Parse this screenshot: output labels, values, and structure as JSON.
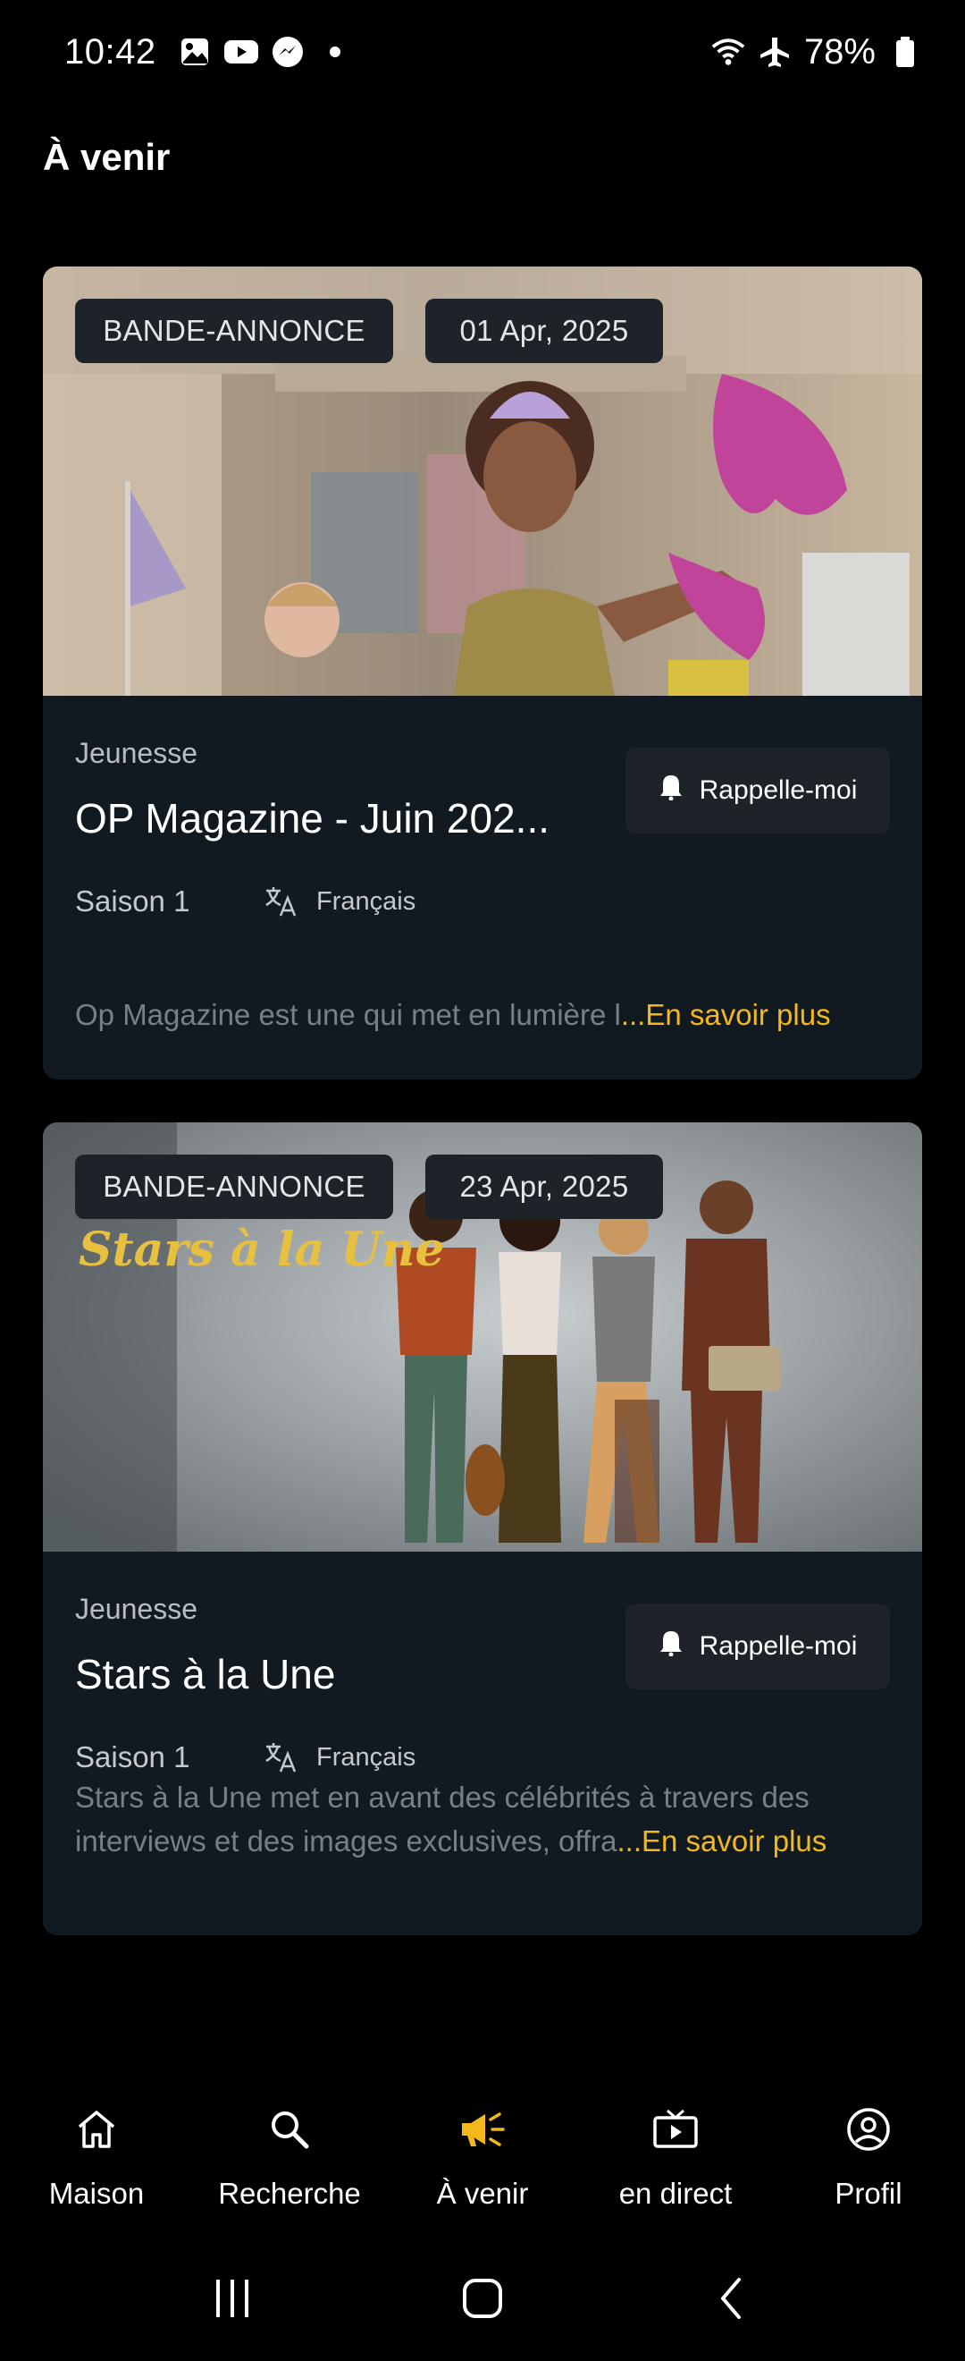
{
  "status_bar": {
    "time": "10:42",
    "battery": "78%",
    "icons": [
      "gallery-icon",
      "youtube-icon",
      "messenger-icon",
      "wifi-icon",
      "airplane-icon",
      "battery-icon"
    ]
  },
  "header": {
    "title": "À venir"
  },
  "cards": [
    {
      "chip_type": "BANDE-ANNONCE",
      "chip_date": "01 Apr, 2025",
      "genre": "Jeunesse",
      "title": "OP Magazine - Juin 202...",
      "remind_label": "Rappelle-moi",
      "season": "Saison 1",
      "language": "Français",
      "description": "Op Magazine est une qui met en lumière l",
      "more_label": "...En savoir plus"
    },
    {
      "chip_type": "BANDE-ANNONCE",
      "chip_date": "23 Apr, 2025",
      "image_caption": "Stars à la Une",
      "genre": "Jeunesse",
      "title": "Stars à la Une",
      "remind_label": "Rappelle-moi",
      "season": "Saison 1",
      "language": "Français",
      "description": "Stars à la Une met en avant des célébrités à travers des interviews et des images exclusives, offra",
      "more_label": "...En savoir plus"
    }
  ],
  "bottom_nav": {
    "items": [
      {
        "label": "Maison",
        "icon": "home-icon"
      },
      {
        "label": "Recherche",
        "icon": "search-icon"
      },
      {
        "label": "À venir",
        "icon": "megaphone-icon",
        "active": true
      },
      {
        "label": "en direct",
        "icon": "live-tv-icon"
      },
      {
        "label": "Profil",
        "icon": "profile-icon"
      }
    ]
  },
  "colors": {
    "background": "#000000",
    "card": "#121a21",
    "chip": "#1d2328",
    "accent": "#f2b81c",
    "muted_text": "#7a7f83"
  }
}
